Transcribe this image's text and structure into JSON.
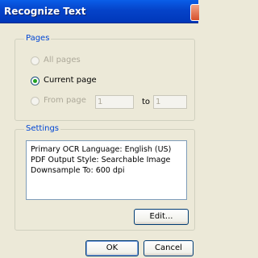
{
  "window": {
    "title": "Recognize Text"
  },
  "pages": {
    "group_label": "Pages",
    "all_pages": "All pages",
    "current_page": "Current page",
    "from_page": "From page",
    "from_value": "1",
    "to_label": "to",
    "to_value": "1",
    "selected": "current_page"
  },
  "settings": {
    "group_label": "Settings",
    "lines": [
      "Primary OCR Language: English (US)",
      "PDF Output Style: Searchable Image",
      "Downsample To: 600 dpi"
    ],
    "edit_label": "Edit..."
  },
  "footer": {
    "ok_label": "OK",
    "cancel_label": "Cancel"
  }
}
